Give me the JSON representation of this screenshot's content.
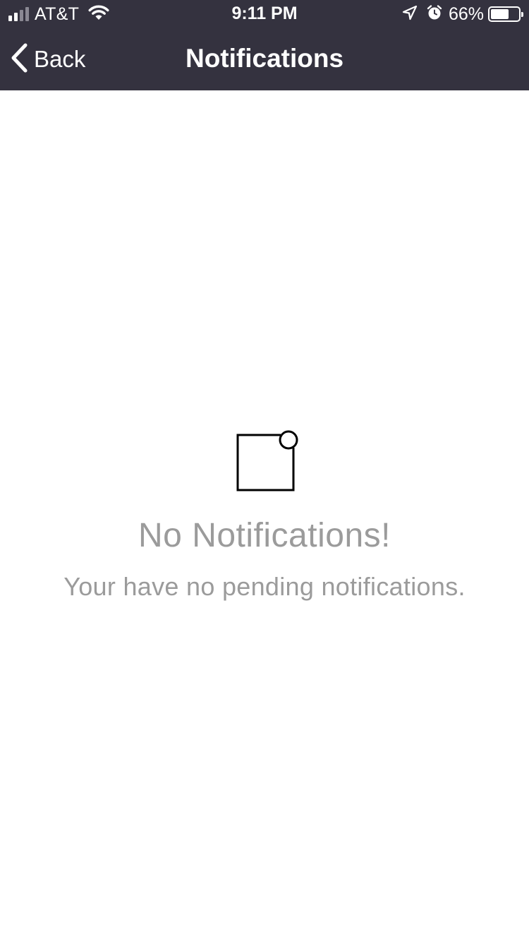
{
  "status_bar": {
    "carrier": "AT&T",
    "time": "9:11 PM",
    "battery_percent_text": "66%",
    "battery_level": 0.66,
    "signal_bars": {
      "active": 2,
      "total": 4
    },
    "icons": [
      "signal-icon",
      "wifi-icon",
      "location-arrow-icon",
      "alarm-icon",
      "battery-icon"
    ]
  },
  "navbar": {
    "back_label": "Back",
    "title": "Notifications",
    "background": "#34323f"
  },
  "empty_state": {
    "icon": "notification-badge-icon",
    "title": "No Notifications!",
    "subtitle": "Your have no pending notifications.",
    "text_color": "#9b9b9b"
  }
}
